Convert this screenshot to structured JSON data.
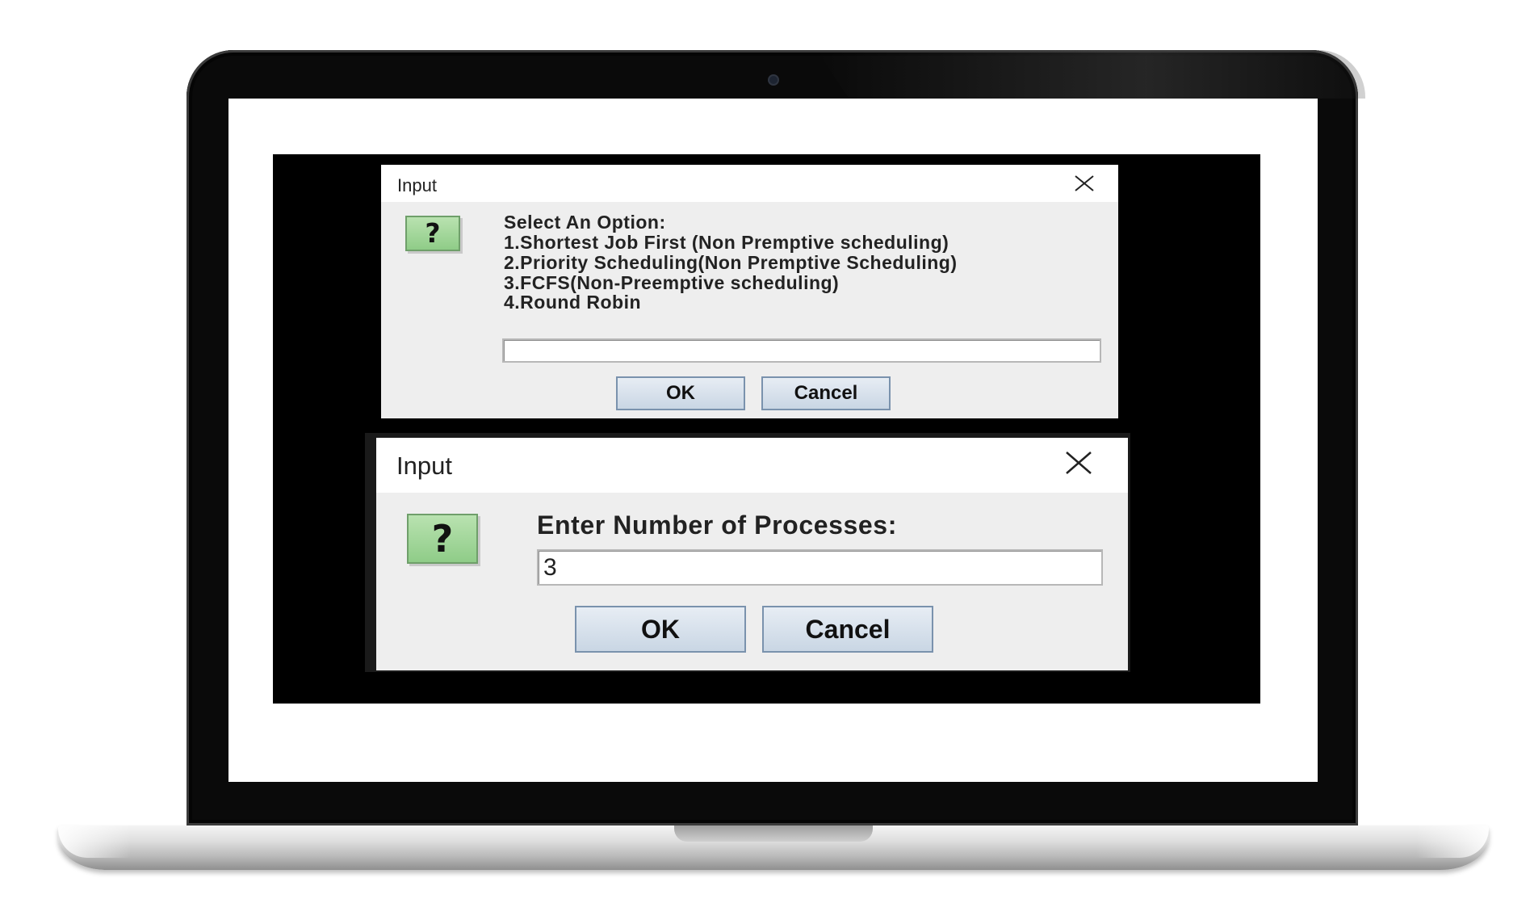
{
  "dialog_options": {
    "title": "Input",
    "icon": "question-icon",
    "message_lines": [
      "Select An Option:",
      "1.Shortest Job First (Non Premptive scheduling)",
      "2.Priority Scheduling(Non Premptive Scheduling)",
      "3.FCFS(Non-Preemptive scheduling)",
      "4.Round Robin"
    ],
    "input_value": "",
    "ok_label": "OK",
    "cancel_label": "Cancel"
  },
  "dialog_processes": {
    "title": "Input",
    "icon": "question-icon",
    "prompt": "Enter Number of Processes:",
    "input_value": "3",
    "ok_label": "OK",
    "cancel_label": "Cancel"
  }
}
